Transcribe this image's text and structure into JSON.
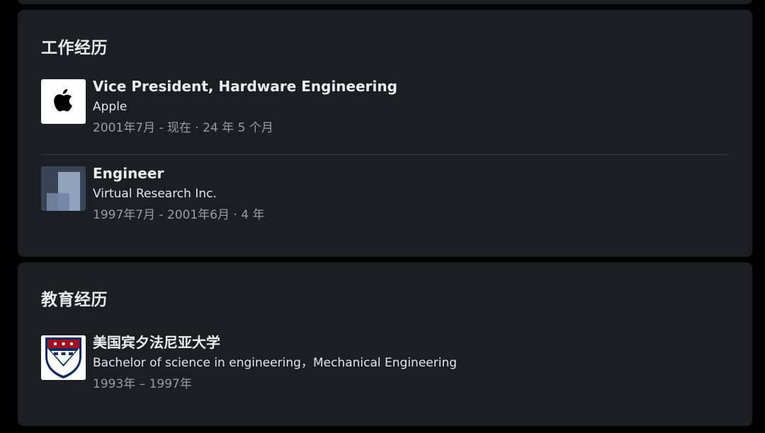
{
  "experience": {
    "title": "工作经历",
    "items": [
      {
        "role": "Vice President, Hardware Engineering",
        "company": "Apple",
        "period": "2001年7月 - 现在 · 24 年 5 个月",
        "logo_icon": "apple-logo-icon"
      },
      {
        "role": "Engineer",
        "company": "Virtual Research Inc.",
        "period": "1997年7月 - 2001年6月 · 4 年",
        "logo_icon": "company-placeholder-icon"
      }
    ]
  },
  "education": {
    "title": "教育经历",
    "items": [
      {
        "school": "美国宾夕法尼亚大学",
        "degree": "Bachelor of science in engineering，Mechanical Engineering",
        "period": "1993年 – 1997年",
        "logo_icon": "university-crest-icon"
      }
    ]
  },
  "colors": {
    "background": "#000000",
    "card": "#1b1f23",
    "text_primary": "#eceded",
    "text_secondary": "#9a9c9f",
    "divider": "#3a3e44",
    "crest_red": "#a50f1e",
    "crest_blue": "#142b6b"
  }
}
